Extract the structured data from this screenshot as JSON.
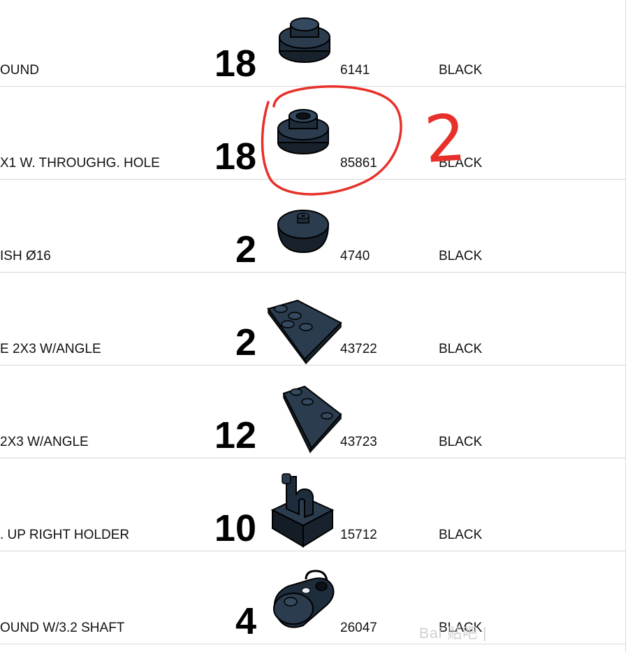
{
  "rows": [
    {
      "description": "OUND",
      "quantity": "18",
      "part_number": "6141",
      "color": "BLACK",
      "icon": "round-plate-1x1-icon"
    },
    {
      "description": "X1 W. THROUGHG. HOLE",
      "quantity": "18",
      "part_number": "85861",
      "color": "BLACK",
      "icon": "round-plate-with-hole-icon"
    },
    {
      "description": "ISH Ø16",
      "quantity": "2",
      "part_number": "4740",
      "color": "BLACK",
      "icon": "dish-icon"
    },
    {
      "description": "E 2X3 W/ANGLE",
      "quantity": "2",
      "part_number": "43722",
      "color": "BLACK",
      "icon": "wedge-plate-left-icon"
    },
    {
      "description": "2X3 W/ANGLE",
      "quantity": "12",
      "part_number": "43723",
      "color": "BLACK",
      "icon": "wedge-plate-right-icon"
    },
    {
      "description": ". UP RIGHT HOLDER",
      "quantity": "10",
      "part_number": "15712",
      "color": "BLACK",
      "icon": "clip-plate-icon"
    },
    {
      "description": "OUND W/3.2 SHAFT",
      "quantity": "4",
      "part_number": "26047",
      "color": "BLACK",
      "icon": "round-plate-with-shaft-icon"
    }
  ],
  "annotation": {
    "handwritten_number": "2",
    "color": "#e8302a"
  },
  "watermark": "Bai 贴吧 |",
  "colors": {
    "brick": "#1e2d3b",
    "brick_edge": "#000000",
    "annotation": "#e8302a"
  }
}
